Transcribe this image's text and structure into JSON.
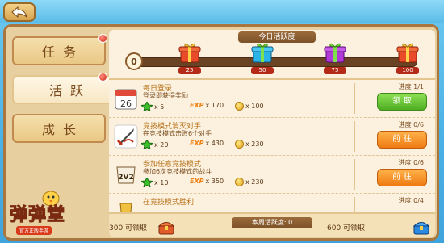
{
  "nav": {
    "items": [
      {
        "label": "任务",
        "active": false,
        "dot": true
      },
      {
        "label": "活跃",
        "active": true,
        "dot": true
      },
      {
        "label": "成长",
        "active": false,
        "dot": false
      }
    ]
  },
  "activity": {
    "title": "今日活跃度",
    "current": "0",
    "milestones": [
      "25",
      "50",
      "75",
      "100"
    ]
  },
  "tasks": [
    {
      "title": "每日登录",
      "desc": "登录即获得奖励",
      "progress": "进度 1/1",
      "star": "x 5",
      "exp_label": "EXP",
      "exp": "x 170",
      "coin": "x 100",
      "button": "领取",
      "button_color": "#4fae22",
      "icon": "calendar-icon"
    },
    {
      "title": "竞技模式消灭对手",
      "desc": "在竞技模式击败6个对手",
      "progress": "进度 0/6",
      "star": "x 20",
      "exp_label": "EXP",
      "exp": "x 430",
      "coin": "x 230",
      "button": "前往",
      "button_color": "#ef7a12",
      "icon": "sword-icon"
    },
    {
      "title": "参加任意竞技模式",
      "desc": "参加6次竞技模式的战斗",
      "progress": "进度 0/6",
      "star": "x 10",
      "exp_label": "EXP",
      "exp": "x 350",
      "coin": "x 230",
      "button": "前往",
      "button_color": "#ef7a12",
      "icon": "2v2-icon"
    },
    {
      "title": "在竞技模式胜利",
      "desc": "",
      "progress": "进度 0/4",
      "star": "",
      "exp_label": "",
      "exp": "",
      "coin": "",
      "button": "",
      "button_color": "#ef7a12",
      "icon": "trophy-icon"
    }
  ],
  "weekly": {
    "label": "本周活跃度: 0",
    "left": "300  可领取",
    "right": "600  可领取"
  },
  "logo": {
    "title": "弹弹堂",
    "subtitle": "官方正版手游"
  }
}
